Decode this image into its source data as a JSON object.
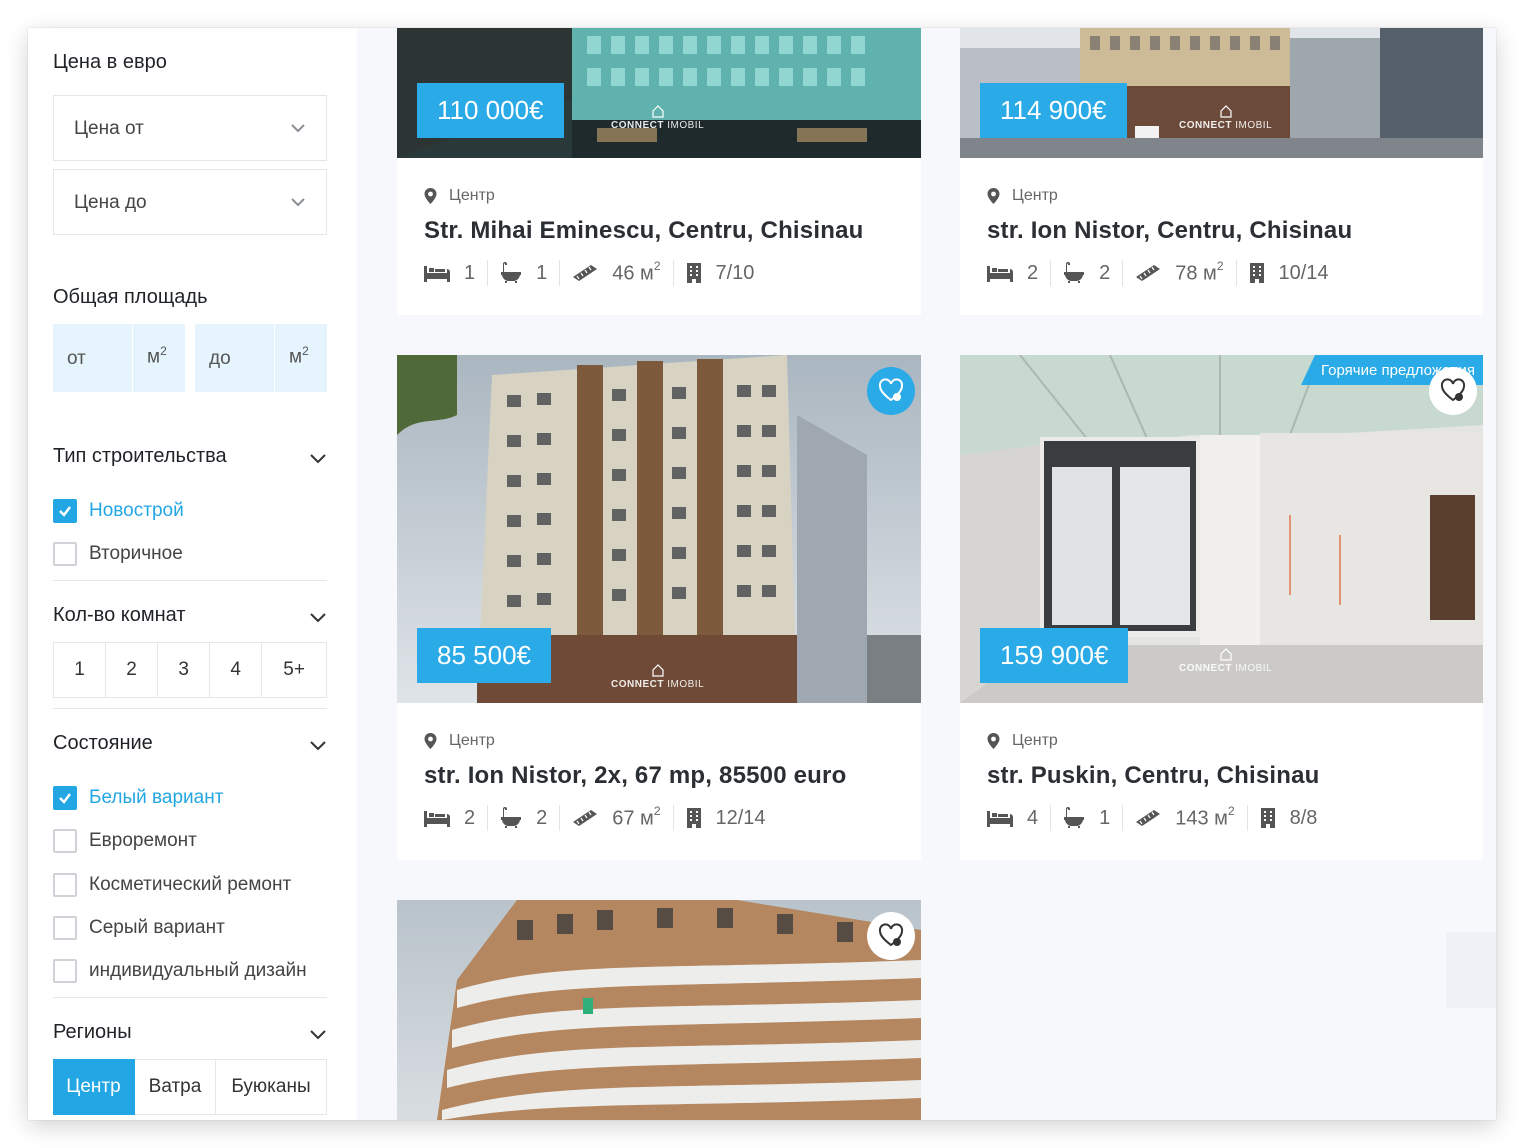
{
  "sidebar": {
    "price": {
      "title": "Цена в евро",
      "from_label": "Цена от",
      "to_label": "Цена до"
    },
    "area": {
      "title": "Общая площадь",
      "from_placeholder": "от",
      "to_placeholder": "до",
      "unit": "м",
      "unit_power": "2"
    },
    "build_type": {
      "title": "Тип строительства",
      "options": [
        {
          "label": "Новострой",
          "checked": true
        },
        {
          "label": "Вторичное",
          "checked": false
        }
      ]
    },
    "rooms": {
      "title": "Кол-во комнат",
      "options": [
        "1",
        "2",
        "3",
        "4",
        "5+"
      ]
    },
    "condition": {
      "title": "Состояние",
      "options": [
        {
          "label": "Белый вариант",
          "checked": true
        },
        {
          "label": "Евроремонт",
          "checked": false
        },
        {
          "label": "Косметический ремонт",
          "checked": false
        },
        {
          "label": "Серый вариант",
          "checked": false
        },
        {
          "label": "индивидуальный дизайн",
          "checked": false
        }
      ]
    },
    "regions": {
      "title": "Регионы",
      "options": [
        {
          "label": "Центр",
          "active": true
        },
        {
          "label": "Ватра",
          "active": false
        },
        {
          "label": "Буюканы",
          "active": false
        }
      ]
    }
  },
  "watermark": {
    "brand_bold": "CONNECT",
    "brand_light": "IMOBIL"
  },
  "listings": [
    {
      "price": "110 000€",
      "location": "Центр",
      "address": "Str. Mihai Eminescu, Centru, Chisinau",
      "bedrooms": "1",
      "bathrooms": "1",
      "area": "46 м",
      "area_power": "2",
      "floor": "7/10"
    },
    {
      "price": "114 900€",
      "location": "Центр",
      "address": "str. Ion Nistor, Centru, Chisinau",
      "bedrooms": "2",
      "bathrooms": "2",
      "area": "78 м",
      "area_power": "2",
      "floor": "10/14"
    },
    {
      "price": "85 500€",
      "location": "Центр",
      "address": "str. Ion Nistor, 2x, 67 mp, 85500 euro",
      "bedrooms": "2",
      "bathrooms": "2",
      "area": "67 м",
      "area_power": "2",
      "floor": "12/14"
    },
    {
      "price": "159 900€",
      "badge": "Горячие предложения",
      "location": "Центр",
      "address": "str. Puskin, Centru, Chisinau",
      "bedrooms": "4",
      "bathrooms": "1",
      "area": "143 м",
      "area_power": "2",
      "floor": "8/8"
    },
    {
      "price": ""
    }
  ],
  "colors": {
    "accent": "#2aaae6",
    "page_bg": "#f6f8fb",
    "area_bg": "#e6f5fd"
  },
  "icons": [
    "chevron-down-icon",
    "check-icon",
    "location-pin-icon",
    "bed-icon",
    "bath-icon",
    "ruler-icon",
    "building-icon",
    "heart-icon",
    "house-icon"
  ]
}
